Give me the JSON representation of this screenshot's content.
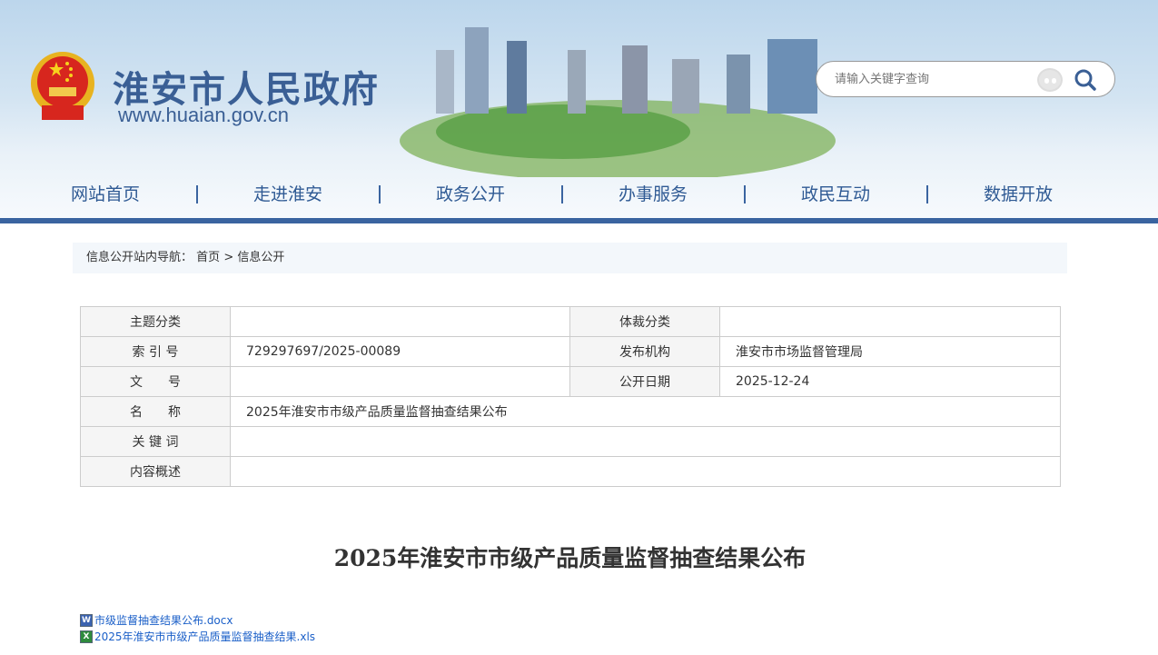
{
  "header": {
    "site_title": "淮安市人民政府",
    "site_url": "www.huaian.gov.cn",
    "search_placeholder": "请输入关键字查询"
  },
  "nav": [
    "网站首页",
    "走进淮安",
    "政务公开",
    "办事服务",
    "政民互动",
    "数据开放"
  ],
  "breadcrumb": {
    "label": "信息公开站内导航：",
    "home": "首页",
    "sep": ">",
    "current": "信息公开"
  },
  "meta": {
    "topic_label": "主题分类",
    "topic_value": "",
    "genre_label": "体裁分类",
    "genre_value": "",
    "index_label": "索 引 号",
    "index_value": "729297697/2025-00089",
    "publisher_label": "发布机构",
    "publisher_value": "淮安市市场监督管理局",
    "docno_label": "文　　号",
    "docno_value": "",
    "date_label": "公开日期",
    "date_value": "2025-12-24",
    "name_label": "名　　称",
    "name_value": "2025年淮安市市级产品质量监督抽查结果公布",
    "keywords_label": "关 键 词",
    "keywords_value": "",
    "summary_label": "内容概述",
    "summary_value": ""
  },
  "doc_title": "2025年淮安市市级产品质量监督抽查结果公布",
  "attachments": [
    {
      "name": "市级监督抽查结果公布.docx",
      "type": "word"
    },
    {
      "name": "2025年淮安市市级产品质量监督抽查结果.xls",
      "type": "excel"
    }
  ],
  "colors": {
    "brand": "#3a64a0",
    "link": "#1a5fc8"
  }
}
